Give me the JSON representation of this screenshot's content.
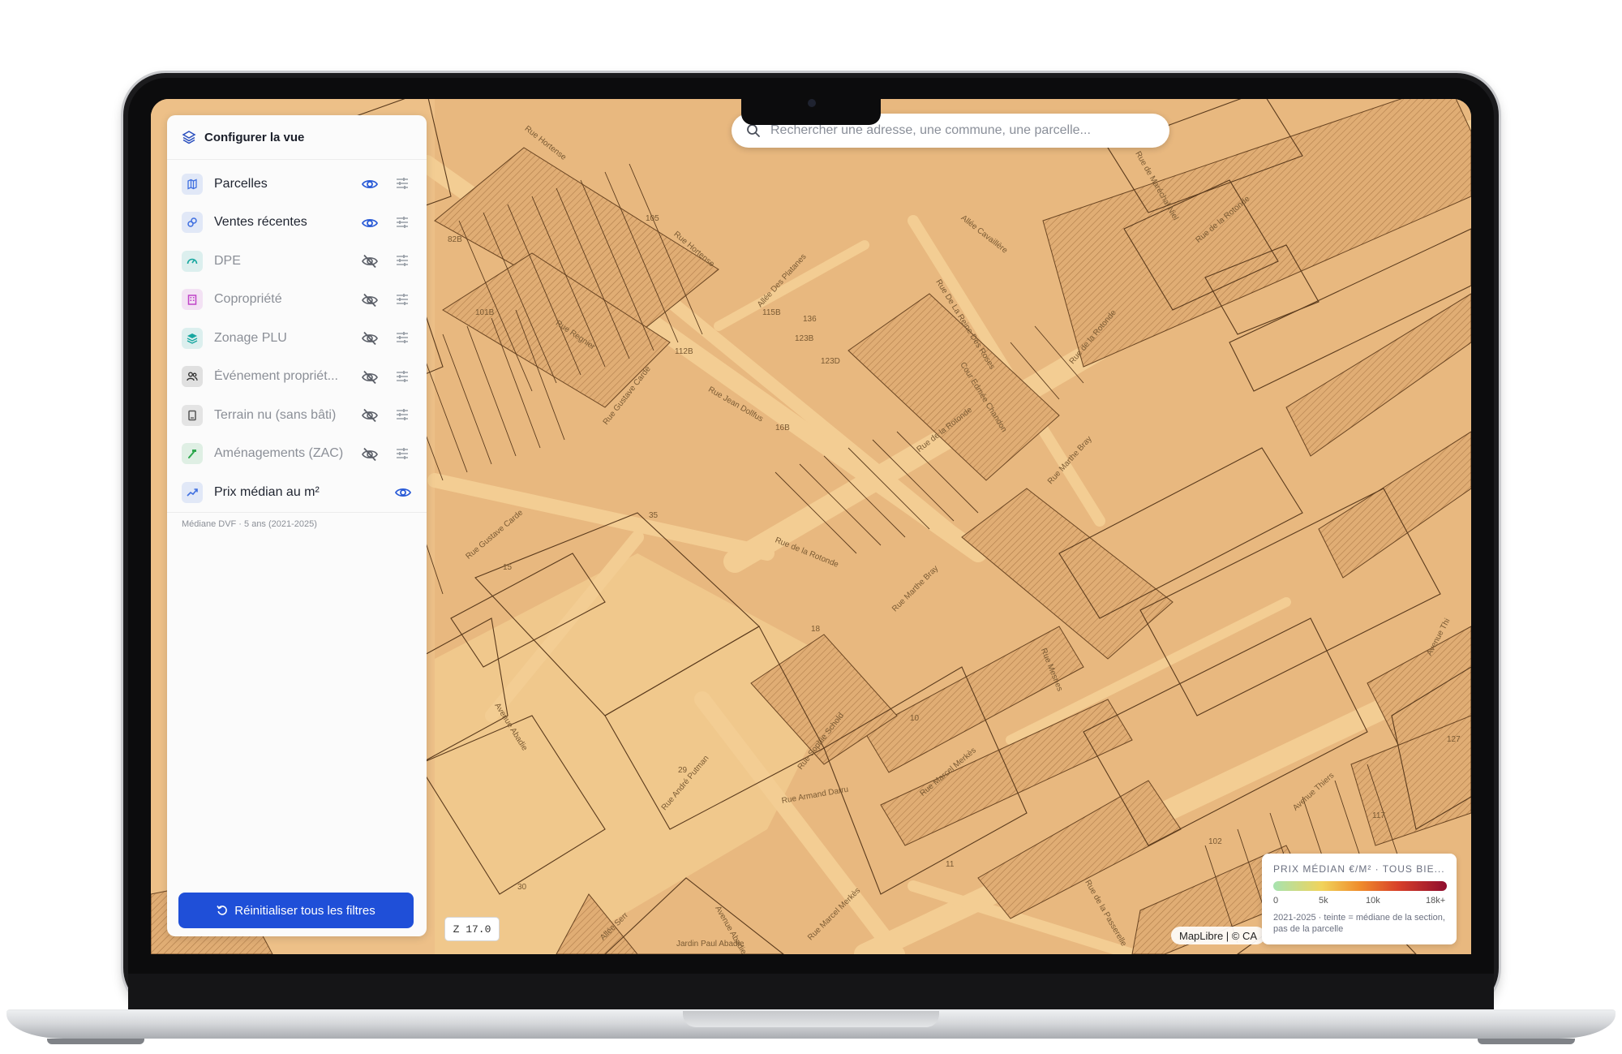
{
  "search": {
    "placeholder": "Rechercher une adresse, une commune, une parcelle..."
  },
  "panel": {
    "title": "Configurer la vue",
    "layers": [
      {
        "label": "Parcelles",
        "visible": true,
        "icon": "map-icon",
        "color": "#3f6fe0"
      },
      {
        "label": "Ventes récentes",
        "visible": true,
        "icon": "link-icon",
        "color": "#3f6fe0"
      },
      {
        "label": "DPE",
        "visible": false,
        "icon": "gauge-icon",
        "color": "#18a7a0"
      },
      {
        "label": "Copropriété",
        "visible": false,
        "icon": "building-icon",
        "color": "#c044c8"
      },
      {
        "label": "Zonage PLU",
        "visible": false,
        "icon": "layers-icon",
        "color": "#18a7a0"
      },
      {
        "label": "Événement propriét...",
        "visible": false,
        "icon": "users-icon",
        "color": "#333333"
      },
      {
        "label": "Terrain nu (sans bâti)",
        "visible": false,
        "icon": "square-icon",
        "color": "#555555"
      },
      {
        "label": "Aménagements (ZAC)",
        "visible": false,
        "icon": "hammer-icon",
        "color": "#2fa84f"
      },
      {
        "label": "Prix médian au m²",
        "visible": true,
        "icon": "trend-icon",
        "color": "#3f6fe0"
      }
    ],
    "note": "Médiane DVF · 5 ans (2021-2025)",
    "reset_label": "Réinitialiser tous les filtres"
  },
  "map": {
    "zoom_label": "Z 17.0",
    "attribution": "MapLibre | © CA",
    "streets": [
      "Rue Hortense",
      "Rue Hortense",
      "Allée Cavaillère",
      "Rue de Maréchal Niel",
      "Rue de la Rotonde",
      "Rue Regnier",
      "Allée Des Platanes",
      "Rue De La Reine Des Roses",
      "Cour Edmée Chandon",
      "Rue de la Rotonde",
      "Rue Gustave Carde",
      "Rue Jean Dollfus",
      "Rue de la Rotonde",
      "Rue de la Rotonde",
      "Rue Marthe Bray",
      "Rue Gustave Carde",
      "Rue Marthe Bray",
      "Rue Mesnes",
      "Avenue Abadie",
      "Rue Sophie Schold",
      "Rue André Putman",
      "Rue Armand Darru",
      "Rue Marcel Merkès",
      "Rue de la Passerelle",
      "Avenue Thiers",
      "Avenue Abadie",
      "Allée Serr",
      "Rue Marcel Merkès",
      "Avenue Thi",
      "Jardin Paul Abadie"
    ],
    "numbers": [
      "105",
      "82B",
      "101B",
      "115B",
      "136",
      "123B",
      "112B",
      "123D",
      "16B",
      "35",
      "15",
      "18",
      "10",
      "29",
      "11",
      "102",
      "30",
      "127",
      "117"
    ]
  },
  "legend": {
    "title": "PRIX MÉDIAN €/M² · TOUS BIE...",
    "ticks": [
      "0",
      "5k",
      "10k",
      "18k+"
    ],
    "note": "2021-2025 · teinte = médiane de la section, pas de la parcelle"
  }
}
